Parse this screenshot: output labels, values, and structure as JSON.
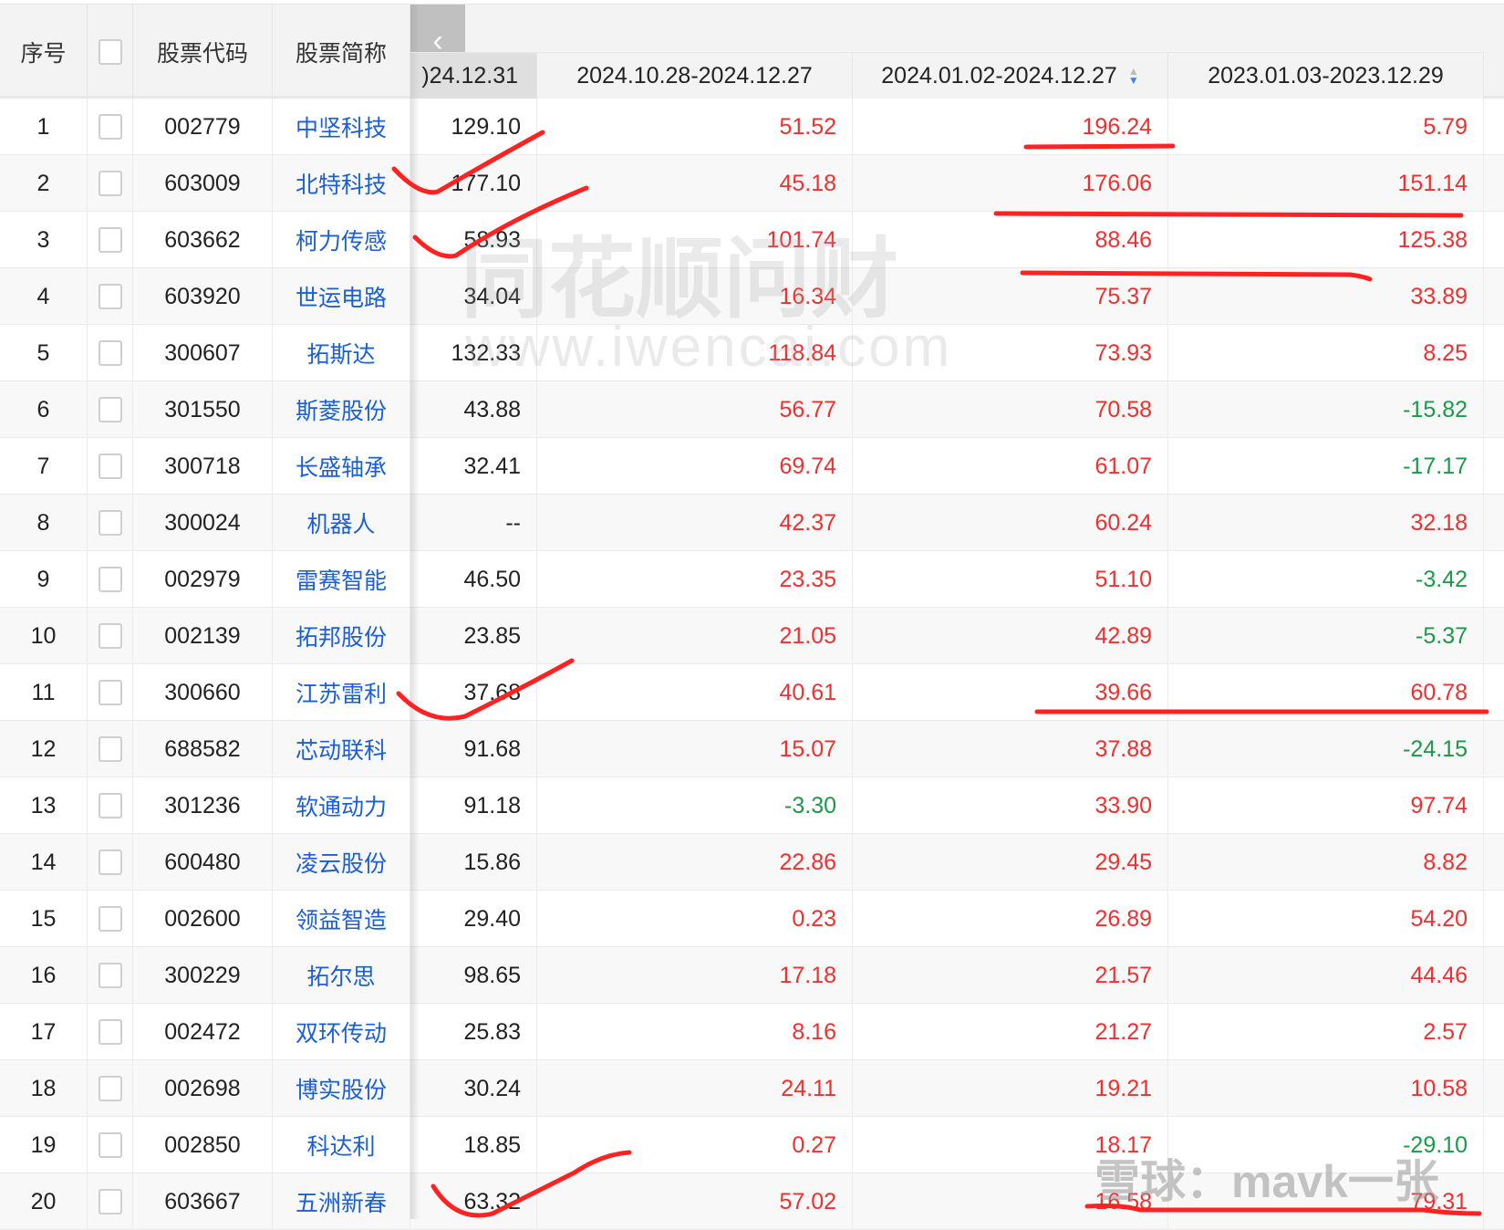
{
  "header": {
    "no": "序号",
    "code": "股票代码",
    "name": "股票简称",
    "col1_partial": ")24.12.31",
    "col2": "2024.10.28-2024.12.27",
    "col3": "2024.01.02-2024.12.27",
    "col4": "2023.01.03-2023.12.29"
  },
  "watermarks": {
    "iwencai_cn": "同花顺问财",
    "iwencai_url": "www.iwencai.com",
    "xueqiu": "雪球：mavk一张"
  },
  "colors": {
    "up": "#f0302e",
    "down": "#1a9a48",
    "link": "#1a5fd8"
  },
  "rows": [
    [
      "1",
      "002779",
      "中坚科技",
      "129.10",
      "51.52",
      "196.24",
      "5.79"
    ],
    [
      "2",
      "603009",
      "北特科技",
      "177.10",
      "45.18",
      "176.06",
      "151.14"
    ],
    [
      "3",
      "603662",
      "柯力传感",
      "58.93",
      "101.74",
      "88.46",
      "125.38"
    ],
    [
      "4",
      "603920",
      "世运电路",
      "34.04",
      "16.34",
      "75.37",
      "33.89"
    ],
    [
      "5",
      "300607",
      "拓斯达",
      "132.33",
      "118.84",
      "73.93",
      "8.25"
    ],
    [
      "6",
      "301550",
      "斯菱股份",
      "43.88",
      "56.77",
      "70.58",
      "-15.82"
    ],
    [
      "7",
      "300718",
      "长盛轴承",
      "32.41",
      "69.74",
      "61.07",
      "-17.17"
    ],
    [
      "8",
      "300024",
      "机器人",
      "--",
      "42.37",
      "60.24",
      "32.18"
    ],
    [
      "9",
      "002979",
      "雷赛智能",
      "46.50",
      "23.35",
      "51.10",
      "-3.42"
    ],
    [
      "10",
      "002139",
      "拓邦股份",
      "23.85",
      "21.05",
      "42.89",
      "-5.37"
    ],
    [
      "11",
      "300660",
      "江苏雷利",
      "37.68",
      "40.61",
      "39.66",
      "60.78"
    ],
    [
      "12",
      "688582",
      "芯动联科",
      "91.68",
      "15.07",
      "37.88",
      "-24.15"
    ],
    [
      "13",
      "301236",
      "软通动力",
      "91.18",
      "-3.30",
      "33.90",
      "97.74"
    ],
    [
      "14",
      "600480",
      "凌云股份",
      "15.86",
      "22.86",
      "29.45",
      "8.82"
    ],
    [
      "15",
      "002600",
      "领益智造",
      "29.40",
      "0.23",
      "26.89",
      "54.20"
    ],
    [
      "16",
      "300229",
      "拓尔思",
      "98.65",
      "17.18",
      "21.57",
      "44.46"
    ],
    [
      "17",
      "002472",
      "双环传动",
      "25.83",
      "8.16",
      "21.27",
      "2.57"
    ],
    [
      "18",
      "002698",
      "博实股份",
      "30.24",
      "24.11",
      "19.21",
      "10.58"
    ],
    [
      "19",
      "002850",
      "科达利",
      "18.85",
      "0.27",
      "18.17",
      "-29.10"
    ],
    [
      "20",
      "603667",
      "五洲新春",
      "63.32",
      "57.02",
      "16.58",
      "79.31"
    ]
  ]
}
